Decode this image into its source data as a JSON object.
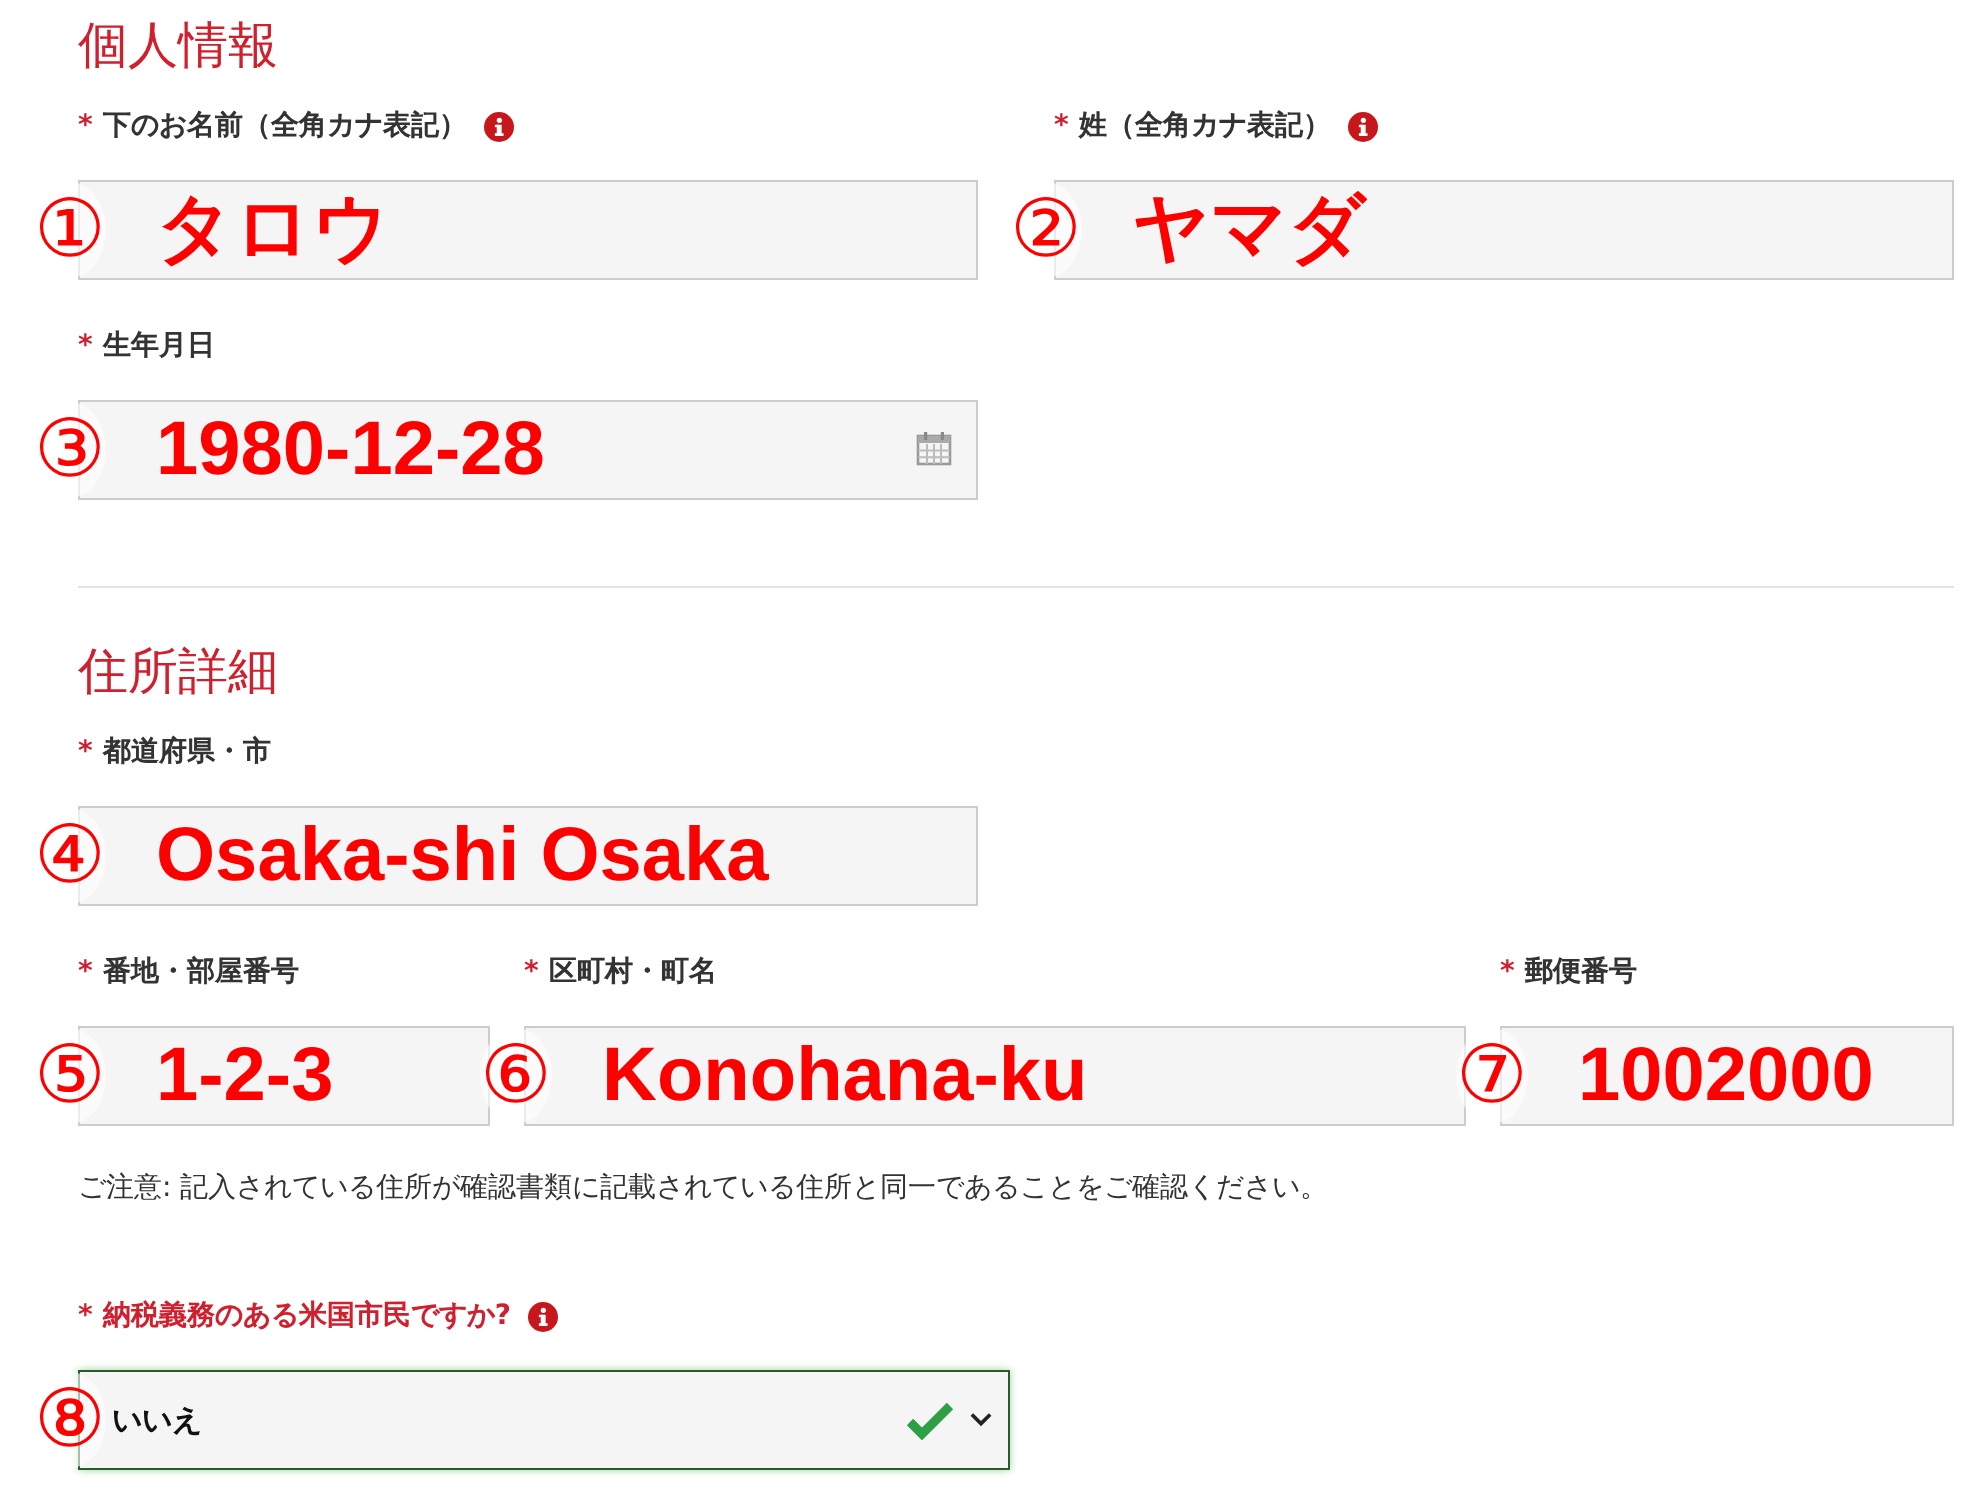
{
  "sections": [
    {
      "title": "個人情報",
      "rows": [
        [
          {
            "mark": "*",
            "label": "下のお名前（全角カナ表記）",
            "info": true,
            "marker": "①",
            "value": "タロウ",
            "kind": "text"
          },
          {
            "mark": "*",
            "label": "姓（全角カナ表記）",
            "info": true,
            "marker": "②",
            "value": "ヤマダ",
            "kind": "text"
          }
        ],
        [
          {
            "mark": "*",
            "label": "生年月日",
            "info": false,
            "marker": "③",
            "value": "1980-12-28",
            "kind": "date"
          }
        ]
      ]
    },
    {
      "title": "住所詳細",
      "rows": [
        [
          {
            "mark": "*",
            "label": "都道府県・市",
            "info": false,
            "marker": "④",
            "value": "Osaka-shi Osaka",
            "kind": "text"
          }
        ],
        [
          {
            "mark": "*",
            "label": "番地・部屋番号",
            "info": false,
            "marker": "⑤",
            "value": "1-2-3",
            "kind": "text"
          },
          {
            "mark": "*",
            "label": "区町村・町名",
            "info": false,
            "marker": "⑥",
            "value": "Konohana-ku",
            "kind": "text"
          },
          {
            "mark": "*",
            "label": "郵便番号",
            "info": false,
            "marker": "⑦",
            "value": "1002000",
            "kind": "text"
          }
        ]
      ]
    }
  ],
  "notice": "ご注意: 記入されている住所が確認書類に記載されている住所と同一であることをご確認ください。",
  "question": {
    "mark": "*",
    "label": "納税義務のある米国市民ですか?",
    "info": true,
    "marker": "⑧",
    "value": "いいえ",
    "valid": true
  }
}
